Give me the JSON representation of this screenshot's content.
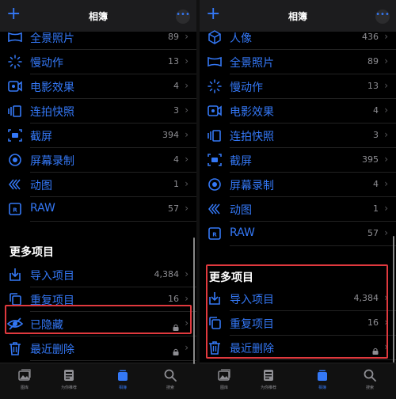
{
  "colors": {
    "accent": "#3478f6",
    "highlight": "#e0393e",
    "muted": "#8e8e93"
  },
  "left": {
    "title": "相簿",
    "rows": [
      {
        "label": "全景照片",
        "count": "89",
        "icon": "panorama-icon"
      },
      {
        "label": "慢动作",
        "count": "13",
        "icon": "slow-motion-icon"
      },
      {
        "label": "电影效果",
        "count": "4",
        "icon": "cinematic-icon"
      },
      {
        "label": "连拍快照",
        "count": "3",
        "icon": "burst-icon"
      },
      {
        "label": "截屏",
        "count": "394",
        "icon": "screenshot-icon"
      },
      {
        "label": "屏幕录制",
        "count": "4",
        "icon": "screen-recording-icon"
      },
      {
        "label": "动图",
        "count": "1",
        "icon": "animated-icon"
      },
      {
        "label": "RAW",
        "count": "57",
        "icon": "raw-icon"
      }
    ],
    "section": "更多项目",
    "more": [
      {
        "label": "导入项目",
        "count": "4,384",
        "icon": "import-icon"
      },
      {
        "label": "重复项目",
        "count": "16",
        "icon": "duplicates-icon"
      },
      {
        "label": "已隐藏",
        "count": "",
        "icon": "hidden-icon",
        "locked": true
      },
      {
        "label": "最近删除",
        "count": "",
        "icon": "trash-icon",
        "locked": true
      }
    ]
  },
  "right": {
    "title": "相簿",
    "rows": [
      {
        "label": "人像",
        "count": "436",
        "icon": "portrait-icon"
      },
      {
        "label": "全景照片",
        "count": "89",
        "icon": "panorama-icon"
      },
      {
        "label": "慢动作",
        "count": "13",
        "icon": "slow-motion-icon"
      },
      {
        "label": "电影效果",
        "count": "4",
        "icon": "cinematic-icon"
      },
      {
        "label": "连拍快照",
        "count": "3",
        "icon": "burst-icon"
      },
      {
        "label": "截屏",
        "count": "395",
        "icon": "screenshot-icon"
      },
      {
        "label": "屏幕录制",
        "count": "4",
        "icon": "screen-recording-icon"
      },
      {
        "label": "动图",
        "count": "1",
        "icon": "animated-icon"
      },
      {
        "label": "RAW",
        "count": "57",
        "icon": "raw-icon"
      }
    ],
    "section": "更多项目",
    "more": [
      {
        "label": "导入项目",
        "count": "4,384",
        "icon": "import-icon"
      },
      {
        "label": "重复项目",
        "count": "16",
        "icon": "duplicates-icon"
      },
      {
        "label": "最近删除",
        "count": "",
        "icon": "trash-icon",
        "locked": true
      }
    ]
  },
  "tabs": [
    {
      "label": "图库",
      "icon": "library-icon",
      "active": false
    },
    {
      "label": "为你推荐",
      "icon": "for-you-icon",
      "active": false
    },
    {
      "label": "相簿",
      "icon": "albums-icon",
      "active": true
    },
    {
      "label": "搜索",
      "icon": "search-icon",
      "active": false
    }
  ]
}
